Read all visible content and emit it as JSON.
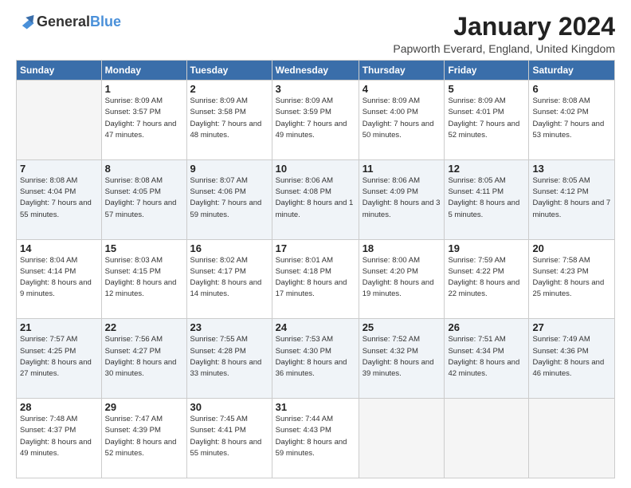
{
  "logo": {
    "general": "General",
    "blue": "Blue"
  },
  "title": "January 2024",
  "location": "Papworth Everard, England, United Kingdom",
  "weekdays": [
    "Sunday",
    "Monday",
    "Tuesday",
    "Wednesday",
    "Thursday",
    "Friday",
    "Saturday"
  ],
  "weeks": [
    [
      {
        "day": "",
        "sunrise": "",
        "sunset": "",
        "daylight": ""
      },
      {
        "day": "1",
        "sunrise": "Sunrise: 8:09 AM",
        "sunset": "Sunset: 3:57 PM",
        "daylight": "Daylight: 7 hours and 47 minutes."
      },
      {
        "day": "2",
        "sunrise": "Sunrise: 8:09 AM",
        "sunset": "Sunset: 3:58 PM",
        "daylight": "Daylight: 7 hours and 48 minutes."
      },
      {
        "day": "3",
        "sunrise": "Sunrise: 8:09 AM",
        "sunset": "Sunset: 3:59 PM",
        "daylight": "Daylight: 7 hours and 49 minutes."
      },
      {
        "day": "4",
        "sunrise": "Sunrise: 8:09 AM",
        "sunset": "Sunset: 4:00 PM",
        "daylight": "Daylight: 7 hours and 50 minutes."
      },
      {
        "day": "5",
        "sunrise": "Sunrise: 8:09 AM",
        "sunset": "Sunset: 4:01 PM",
        "daylight": "Daylight: 7 hours and 52 minutes."
      },
      {
        "day": "6",
        "sunrise": "Sunrise: 8:08 AM",
        "sunset": "Sunset: 4:02 PM",
        "daylight": "Daylight: 7 hours and 53 minutes."
      }
    ],
    [
      {
        "day": "7",
        "sunrise": "Sunrise: 8:08 AM",
        "sunset": "Sunset: 4:04 PM",
        "daylight": "Daylight: 7 hours and 55 minutes."
      },
      {
        "day": "8",
        "sunrise": "Sunrise: 8:08 AM",
        "sunset": "Sunset: 4:05 PM",
        "daylight": "Daylight: 7 hours and 57 minutes."
      },
      {
        "day": "9",
        "sunrise": "Sunrise: 8:07 AM",
        "sunset": "Sunset: 4:06 PM",
        "daylight": "Daylight: 7 hours and 59 minutes."
      },
      {
        "day": "10",
        "sunrise": "Sunrise: 8:06 AM",
        "sunset": "Sunset: 4:08 PM",
        "daylight": "Daylight: 8 hours and 1 minute."
      },
      {
        "day": "11",
        "sunrise": "Sunrise: 8:06 AM",
        "sunset": "Sunset: 4:09 PM",
        "daylight": "Daylight: 8 hours and 3 minutes."
      },
      {
        "day": "12",
        "sunrise": "Sunrise: 8:05 AM",
        "sunset": "Sunset: 4:11 PM",
        "daylight": "Daylight: 8 hours and 5 minutes."
      },
      {
        "day": "13",
        "sunrise": "Sunrise: 8:05 AM",
        "sunset": "Sunset: 4:12 PM",
        "daylight": "Daylight: 8 hours and 7 minutes."
      }
    ],
    [
      {
        "day": "14",
        "sunrise": "Sunrise: 8:04 AM",
        "sunset": "Sunset: 4:14 PM",
        "daylight": "Daylight: 8 hours and 9 minutes."
      },
      {
        "day": "15",
        "sunrise": "Sunrise: 8:03 AM",
        "sunset": "Sunset: 4:15 PM",
        "daylight": "Daylight: 8 hours and 12 minutes."
      },
      {
        "day": "16",
        "sunrise": "Sunrise: 8:02 AM",
        "sunset": "Sunset: 4:17 PM",
        "daylight": "Daylight: 8 hours and 14 minutes."
      },
      {
        "day": "17",
        "sunrise": "Sunrise: 8:01 AM",
        "sunset": "Sunset: 4:18 PM",
        "daylight": "Daylight: 8 hours and 17 minutes."
      },
      {
        "day": "18",
        "sunrise": "Sunrise: 8:00 AM",
        "sunset": "Sunset: 4:20 PM",
        "daylight": "Daylight: 8 hours and 19 minutes."
      },
      {
        "day": "19",
        "sunrise": "Sunrise: 7:59 AM",
        "sunset": "Sunset: 4:22 PM",
        "daylight": "Daylight: 8 hours and 22 minutes."
      },
      {
        "day": "20",
        "sunrise": "Sunrise: 7:58 AM",
        "sunset": "Sunset: 4:23 PM",
        "daylight": "Daylight: 8 hours and 25 minutes."
      }
    ],
    [
      {
        "day": "21",
        "sunrise": "Sunrise: 7:57 AM",
        "sunset": "Sunset: 4:25 PM",
        "daylight": "Daylight: 8 hours and 27 minutes."
      },
      {
        "day": "22",
        "sunrise": "Sunrise: 7:56 AM",
        "sunset": "Sunset: 4:27 PM",
        "daylight": "Daylight: 8 hours and 30 minutes."
      },
      {
        "day": "23",
        "sunrise": "Sunrise: 7:55 AM",
        "sunset": "Sunset: 4:28 PM",
        "daylight": "Daylight: 8 hours and 33 minutes."
      },
      {
        "day": "24",
        "sunrise": "Sunrise: 7:53 AM",
        "sunset": "Sunset: 4:30 PM",
        "daylight": "Daylight: 8 hours and 36 minutes."
      },
      {
        "day": "25",
        "sunrise": "Sunrise: 7:52 AM",
        "sunset": "Sunset: 4:32 PM",
        "daylight": "Daylight: 8 hours and 39 minutes."
      },
      {
        "day": "26",
        "sunrise": "Sunrise: 7:51 AM",
        "sunset": "Sunset: 4:34 PM",
        "daylight": "Daylight: 8 hours and 42 minutes."
      },
      {
        "day": "27",
        "sunrise": "Sunrise: 7:49 AM",
        "sunset": "Sunset: 4:36 PM",
        "daylight": "Daylight: 8 hours and 46 minutes."
      }
    ],
    [
      {
        "day": "28",
        "sunrise": "Sunrise: 7:48 AM",
        "sunset": "Sunset: 4:37 PM",
        "daylight": "Daylight: 8 hours and 49 minutes."
      },
      {
        "day": "29",
        "sunrise": "Sunrise: 7:47 AM",
        "sunset": "Sunset: 4:39 PM",
        "daylight": "Daylight: 8 hours and 52 minutes."
      },
      {
        "day": "30",
        "sunrise": "Sunrise: 7:45 AM",
        "sunset": "Sunset: 4:41 PM",
        "daylight": "Daylight: 8 hours and 55 minutes."
      },
      {
        "day": "31",
        "sunrise": "Sunrise: 7:44 AM",
        "sunset": "Sunset: 4:43 PM",
        "daylight": "Daylight: 8 hours and 59 minutes."
      },
      {
        "day": "",
        "sunrise": "",
        "sunset": "",
        "daylight": ""
      },
      {
        "day": "",
        "sunrise": "",
        "sunset": "",
        "daylight": ""
      },
      {
        "day": "",
        "sunrise": "",
        "sunset": "",
        "daylight": ""
      }
    ]
  ]
}
